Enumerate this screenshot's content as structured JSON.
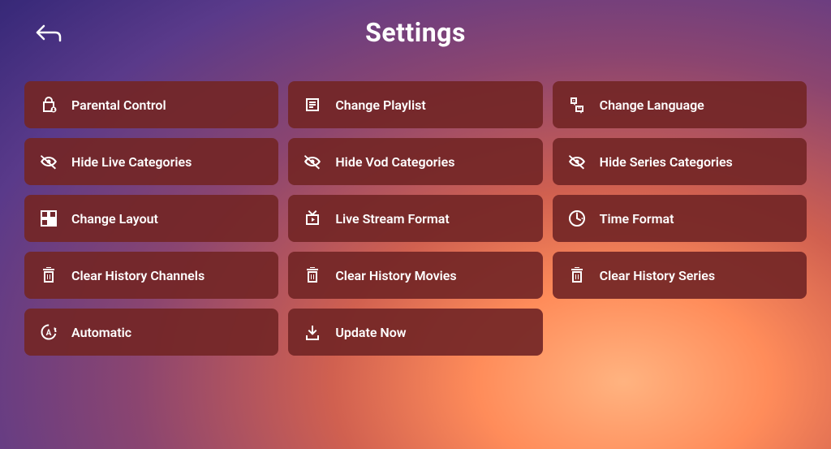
{
  "title": "Settings",
  "items": [
    {
      "label": "Parental Control",
      "icon": "lock"
    },
    {
      "label": "Change Playlist",
      "icon": "playlist"
    },
    {
      "label": "Change Language",
      "icon": "language"
    },
    {
      "label": "Hide Live Categories",
      "icon": "hide"
    },
    {
      "label": "Hide Vod Categories",
      "icon": "hide"
    },
    {
      "label": "Hide Series Categories",
      "icon": "hide"
    },
    {
      "label": "Change Layout",
      "icon": "layout"
    },
    {
      "label": "Live Stream Format",
      "icon": "tv"
    },
    {
      "label": "Time Format",
      "icon": "clock"
    },
    {
      "label": "Clear History Channels",
      "icon": "trash"
    },
    {
      "label": "Clear History Movies",
      "icon": "trash"
    },
    {
      "label": "Clear History Series",
      "icon": "trash"
    },
    {
      "label": "Automatic",
      "icon": "auto"
    },
    {
      "label": "Update Now",
      "icon": "download"
    }
  ]
}
